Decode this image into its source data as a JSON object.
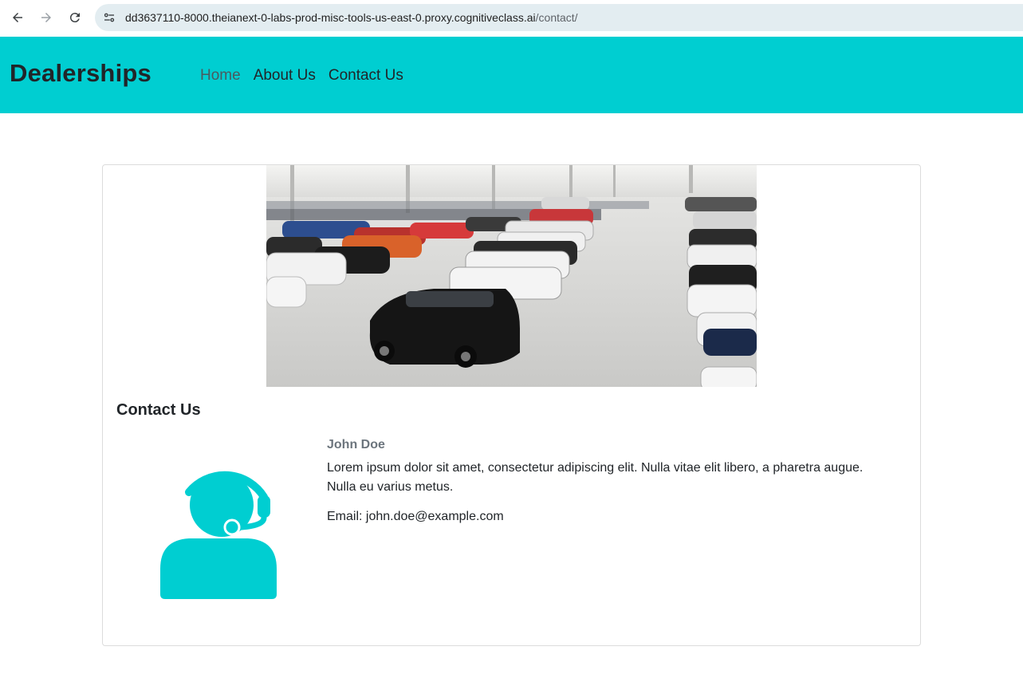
{
  "browser": {
    "url_host": "dd3637110-8000.theianext-0-labs-prod-misc-tools-us-east-0.proxy.cognitiveclass.ai",
    "url_path": "/contact/"
  },
  "navbar": {
    "brand": "Dealerships",
    "links": [
      {
        "label": "Home"
      },
      {
        "label": "About Us"
      },
      {
        "label": "Contact Us"
      }
    ],
    "color": "#00ced1"
  },
  "card": {
    "title": "Contact Us",
    "name": "John Doe",
    "description": "Lorem ipsum dolor sit amet, consectetur adipiscing elit. Nulla vitae elit libero, a pharetra augue. Nulla eu varius metus.",
    "email": "Email: john.doe@example.com"
  }
}
